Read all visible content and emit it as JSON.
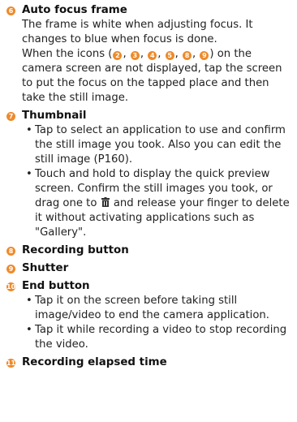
{
  "colors": {
    "accent": "#ee8a2a",
    "text": "#222222"
  },
  "items": [
    {
      "number": "6",
      "title": "Auto focus frame",
      "para1": "The frame is white when adjusting focus. It changes to blue when focus is done.",
      "para2_prefix": "When the icons (",
      "inline_numbers": [
        "2",
        "3",
        "4",
        "5",
        "8",
        "9"
      ],
      "para2_suffix": ") on the camera screen are not displayed, tap the screen to put the focus on the tapped place and then take the still image."
    },
    {
      "number": "7",
      "title": "Thumbnail",
      "bullet1": "Tap to select an application to use and confirm the still image you took. Also you can edit the still image (P160).",
      "bullet2_part1": "Touch and hold to display the quick preview screen. Confirm the still images you took, or drag one to",
      "bullet2_icon": "trash-icon",
      "bullet2_part2": "and release your finger to delete it without activating applications such as \"Gallery\"."
    },
    {
      "number": "8",
      "title": "Recording button"
    },
    {
      "number": "9",
      "title": "Shutter"
    },
    {
      "number": "10",
      "title": "End button",
      "bullet1": "Tap it on the screen before taking still image/video to end the camera application.",
      "bullet2": "Tap it while recording a video to stop recording the video."
    },
    {
      "number": "11",
      "title": "Recording elapsed time"
    }
  ],
  "bullet_char": "•"
}
